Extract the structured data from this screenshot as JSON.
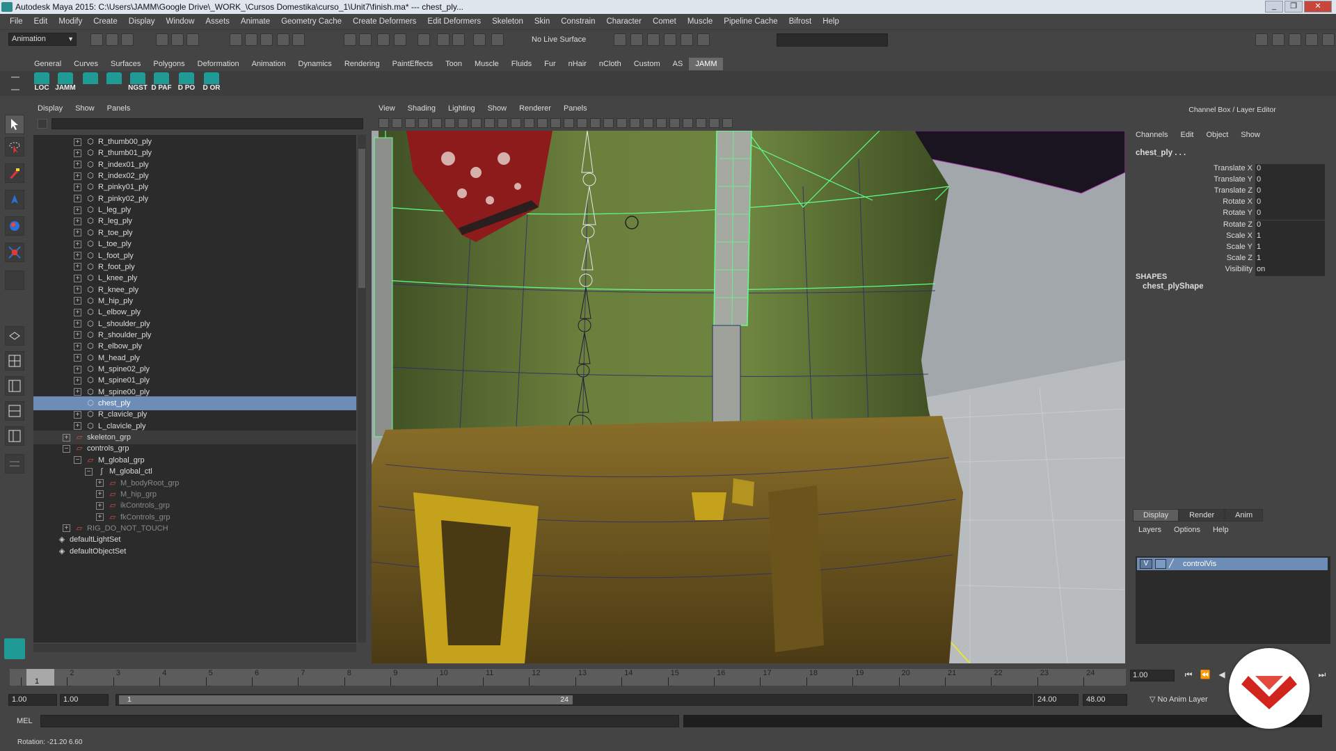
{
  "titlebar": {
    "title": "Autodesk Maya 2015: C:\\Users\\JAMM\\Google Drive\\_WORK_\\Cursos Domestika\\curso_1\\Unit7\\finish.ma*   ---   chest_ply...",
    "minimize": "_",
    "restore": "❐",
    "close": "✕"
  },
  "menubar": [
    "File",
    "Edit",
    "Modify",
    "Create",
    "Display",
    "Window",
    "Assets",
    "Animate",
    "Geometry Cache",
    "Create Deformers",
    "Edit Deformers",
    "Skeleton",
    "Skin",
    "Constrain",
    "Character",
    "Comet",
    "Muscle",
    "Pipeline Cache",
    "Bifrost",
    "Help"
  ],
  "statusline": {
    "mode": "Animation",
    "live_surface": "No Live Surface"
  },
  "shelf": {
    "tabs": [
      "General",
      "Curves",
      "Surfaces",
      "Polygons",
      "Deformation",
      "Animation",
      "Dynamics",
      "Rendering",
      "PaintEffects",
      "Toon",
      "Muscle",
      "Fluids",
      "Fur",
      "nHair",
      "nCloth",
      "Custom",
      "AS",
      "JAMM"
    ],
    "active_tab": "JAMM",
    "buttons": [
      "LOC",
      "JAMM",
      "",
      "",
      "NGST",
      "D PAF",
      "D PO",
      "D OR"
    ]
  },
  "outliner": {
    "menu": [
      "Display",
      "Show",
      "Panels"
    ],
    "rows": [
      {
        "label": "R_thumb00_ply",
        "depth": 4,
        "type": "mesh"
      },
      {
        "label": "R_thumb01_ply",
        "depth": 4,
        "type": "mesh"
      },
      {
        "label": "R_index01_ply",
        "depth": 4,
        "type": "mesh"
      },
      {
        "label": "R_index02_ply",
        "depth": 4,
        "type": "mesh"
      },
      {
        "label": "R_pinky01_ply",
        "depth": 4,
        "type": "mesh"
      },
      {
        "label": "R_pinky02_ply",
        "depth": 4,
        "type": "mesh"
      },
      {
        "label": "L_leg_ply",
        "depth": 4,
        "type": "mesh"
      },
      {
        "label": "R_leg_ply",
        "depth": 4,
        "type": "mesh"
      },
      {
        "label": "R_toe_ply",
        "depth": 4,
        "type": "mesh"
      },
      {
        "label": "L_toe_ply",
        "depth": 4,
        "type": "mesh"
      },
      {
        "label": "L_foot_ply",
        "depth": 4,
        "type": "mesh"
      },
      {
        "label": "R_foot_ply",
        "depth": 4,
        "type": "mesh"
      },
      {
        "label": "L_knee_ply",
        "depth": 4,
        "type": "mesh"
      },
      {
        "label": "R_knee_ply",
        "depth": 4,
        "type": "mesh"
      },
      {
        "label": "M_hip_ply",
        "depth": 4,
        "type": "mesh"
      },
      {
        "label": "L_elbow_ply",
        "depth": 4,
        "type": "mesh"
      },
      {
        "label": "L_shoulder_ply",
        "depth": 4,
        "type": "mesh"
      },
      {
        "label": "R_shoulder_ply",
        "depth": 4,
        "type": "mesh"
      },
      {
        "label": "R_elbow_ply",
        "depth": 4,
        "type": "mesh"
      },
      {
        "label": "M_head_ply",
        "depth": 4,
        "type": "mesh"
      },
      {
        "label": "M_spine02_ply",
        "depth": 4,
        "type": "mesh"
      },
      {
        "label": "M_spine01_ply",
        "depth": 4,
        "type": "mesh"
      },
      {
        "label": "M_spine00_ply",
        "depth": 4,
        "type": "mesh"
      },
      {
        "label": "chest_ply",
        "depth": 4,
        "type": "mesh",
        "selected": true
      },
      {
        "label": "R_clavicle_ply",
        "depth": 4,
        "type": "mesh"
      },
      {
        "label": "L_clavicle_ply",
        "depth": 4,
        "type": "mesh"
      },
      {
        "label": "skeleton_grp",
        "depth": 1,
        "type": "set",
        "group": true
      },
      {
        "label": "controls_grp",
        "depth": 1,
        "type": "set",
        "expanded": true
      },
      {
        "label": "M_global_grp",
        "depth": 2,
        "type": "set",
        "expanded": true
      },
      {
        "label": "M_global_ctl",
        "depth": 3,
        "type": "curve",
        "expanded": true
      },
      {
        "label": "M_bodyRoot_grp",
        "depth": 4,
        "type": "set",
        "dim": true
      },
      {
        "label": "M_hip_grp",
        "depth": 4,
        "type": "set",
        "dim": true
      },
      {
        "label": "ikControls_grp",
        "depth": 4,
        "type": "set",
        "dim": true
      },
      {
        "label": "fkControls_grp",
        "depth": 4,
        "type": "set",
        "dim": true
      },
      {
        "label": "RIG_DO_NOT_TOUCH",
        "depth": 1,
        "type": "set",
        "dim": true
      },
      {
        "label": "defaultLightSet",
        "depth": 0,
        "type": "objset"
      },
      {
        "label": "defaultObjectSet",
        "depth": 0,
        "type": "objset"
      }
    ]
  },
  "viewport": {
    "menu": [
      "View",
      "Shading",
      "Lighting",
      "Show",
      "Renderer",
      "Panels"
    ]
  },
  "channelbox": {
    "title": "Channel Box / Layer Editor",
    "menu": [
      "Channels",
      "Edit",
      "Object",
      "Show"
    ],
    "object": "chest_ply . . .",
    "attributes": [
      {
        "name": "Translate X",
        "value": "0"
      },
      {
        "name": "Translate Y",
        "value": "0"
      },
      {
        "name": "Translate Z",
        "value": "0"
      },
      {
        "name": "Rotate X",
        "value": "0"
      },
      {
        "name": "Rotate Y",
        "value": "0"
      },
      {
        "name": "Rotate Z",
        "value": "0"
      },
      {
        "name": "Scale X",
        "value": "1"
      },
      {
        "name": "Scale Y",
        "value": "1"
      },
      {
        "name": "Scale Z",
        "value": "1"
      },
      {
        "name": "Visibility",
        "value": "on"
      }
    ],
    "shapes_header": "SHAPES",
    "shape": "chest_plyShape"
  },
  "layer_editor": {
    "tabs": [
      "Display",
      "Render",
      "Anim"
    ],
    "active_tab": "Display",
    "menu": [
      "Layers",
      "Options",
      "Help"
    ],
    "layer": {
      "visible": "V",
      "name": "controlVis"
    }
  },
  "timeslider": {
    "ticks": [
      "1",
      "2",
      "3",
      "4",
      "5",
      "6",
      "7",
      "8",
      "9",
      "10",
      "11",
      "12",
      "13",
      "14",
      "15",
      "16",
      "17",
      "18",
      "19",
      "20",
      "21",
      "22",
      "23",
      "24"
    ],
    "current_frame": "1",
    "frame_field": "1.00"
  },
  "rangeslider": {
    "start": "1.00",
    "playback_start": "1.00",
    "range_start": "1",
    "range_end": "24",
    "playback_end": "24.00",
    "end": "48.00",
    "anim_layer": "No Anim Layer"
  },
  "cmdline": {
    "label": "MEL"
  },
  "helpline": {
    "text": "Rotation: -21.20    6.60"
  },
  "colors": {
    "selection": "#6d8db6",
    "shelf_accent": "#1f9a94",
    "mesh_green": "#6a7f3c",
    "brand_red": "#d1241d"
  }
}
